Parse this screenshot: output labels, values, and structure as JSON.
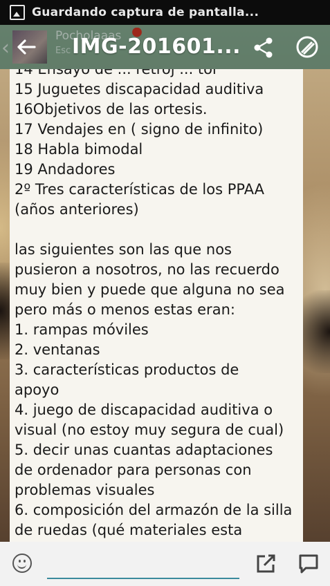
{
  "status_bar": {
    "notification_icon": "screenshot-icon",
    "text": "Guardando captura de pantalla..."
  },
  "chat_header": {
    "name": "Pocholaaas",
    "status": "Esc"
  },
  "gallery_bar": {
    "back_icon": "back-arrow-icon",
    "title": "IMG-201601...",
    "share_icon": "share-icon",
    "edit_icon": "edit-icon"
  },
  "message": {
    "lines": [
      "14 Ensayo de ... retroj ... tor",
      "15 Juguetes discapacidad auditiva",
      "16Objetivos de las ortesis.",
      "17 Vendajes en ( signo de infinito)",
      "18 Habla bimodal",
      "19 Andadores",
      "2º Tres características de los PPAA",
      "(años anteriores)",
      "",
      "las siguientes son las que nos",
      "pusieron a nosotros, no las recuerdo",
      "muy bien y puede que alguna no sea",
      "pero más o menos estas eran:",
      "1. rampas móviles",
      "2. ventanas",
      "3. características productos de",
      "apoyo",
      "4. juego de discapacidad auditiva o",
      "visual (no estoy muy segura de cual)",
      "5. decir unas cuantas adaptaciones",
      "de ordenador para personas con",
      "problemas visuales",
      "6. composición del armazón de la silla",
      "de ruedas (qué materiales esta"
    ]
  },
  "input_bar": {
    "emoji_icon": "emoji-icon",
    "placeholder": "",
    "attach_icon": "edit-square-icon",
    "reply_icon": "reply-bubble-icon"
  },
  "colors": {
    "status_bar_bg": "#0c0c0c",
    "bubble_bg": "#f7f5ef",
    "input_underline": "#3a8a9c"
  }
}
